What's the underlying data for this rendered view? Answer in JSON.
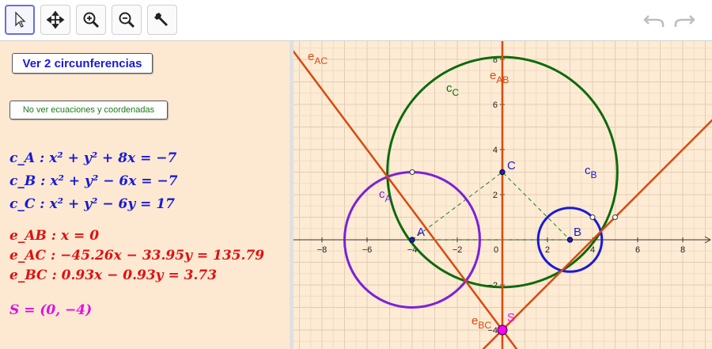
{
  "toolbar": {
    "tools": [
      {
        "name": "move-tool",
        "icon": "cursor-arrow-icon"
      },
      {
        "name": "move-graphics-tool",
        "icon": "move-arrows-icon"
      },
      {
        "name": "zoom-in-tool",
        "icon": "zoom-in-icon"
      },
      {
        "name": "zoom-out-tool",
        "icon": "zoom-out-icon"
      },
      {
        "name": "settings-tool",
        "icon": "wrench-icon"
      }
    ],
    "undo_icon": "undo-icon",
    "redo_icon": "redo-icon"
  },
  "algebra": {
    "button_show": "Ver 2 circunferencias",
    "button_hide_eq": "No ver ecuaciones y coordenadas",
    "equations": {
      "cA": "c_A : x² + y² + 8x = −7",
      "cB": "c_B : x² + y² − 6x = −7",
      "cC": "c_C : x² + y² − 6y = 17",
      "eAB": "e_AB : x = 0",
      "eAC": "e_AC : −45.26x − 33.95y = 135.79",
      "eBC": "e_BC : 0.93x − 0.93y = 3.73",
      "S": "S = (0, −4)"
    }
  },
  "graphics": {
    "x_ticks": [
      "−8",
      "−6",
      "−4",
      "−2",
      "0",
      "2",
      "4",
      "6",
      "8"
    ],
    "y_ticks": [
      "8",
      "6",
      "4",
      "2",
      "−2",
      "−4"
    ],
    "labels": {
      "cA": "cA",
      "cB": "cB",
      "cC": "cC",
      "eAB": "eAB",
      "eAC": "eAC",
      "eBC": "eBC",
      "A": "A",
      "B": "B",
      "C": "C",
      "S": "S"
    },
    "colors": {
      "circle_A": "#7b22d6",
      "circle_B": "#1a1ad6",
      "circle_C": "#0d6a0d",
      "axes_lines": "#d84a10",
      "point_S": "#ff00ff",
      "points": "#1a1ad6"
    },
    "geometry_data": {
      "A": [
        -4,
        0
      ],
      "B": [
        3,
        0
      ],
      "C": [
        0,
        3
      ],
      "S": [
        0,
        -4
      ],
      "rA": 3,
      "rB": 1.414,
      "rC": 5.099
    }
  }
}
